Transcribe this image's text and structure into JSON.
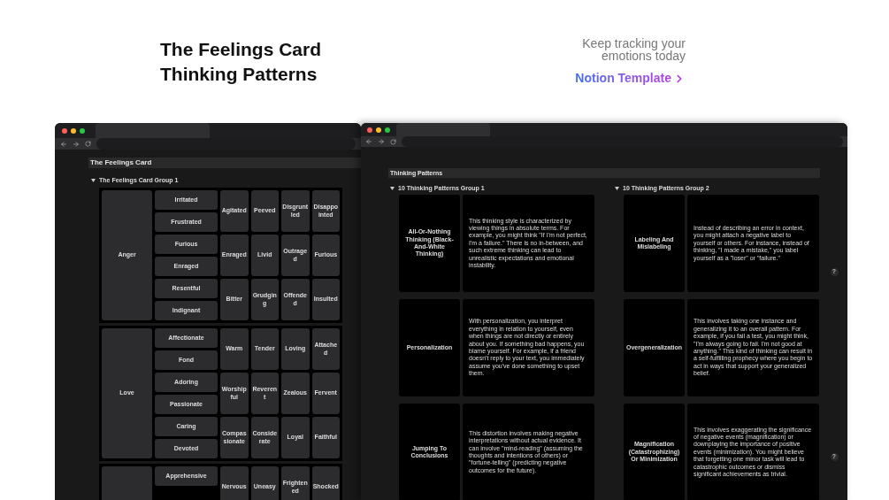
{
  "headline": {
    "title_lines": [
      "The Feelings Card",
      "Thinking Patterns"
    ],
    "tagline_lines": [
      "Keep tracking your",
      "emotions today"
    ],
    "link": "Notion Template"
  },
  "feelings_window": {
    "page_title": "The Feelings Card",
    "group_label": "The Feelings Card Group 1",
    "blocks": [
      {
        "primary": "Anger",
        "secondary": [
          "Irritated",
          "Frustrated",
          "Furious",
          "Enraged",
          "Resentful",
          "Indignant"
        ],
        "tertiary": [
          "Agitated",
          "Peeved",
          "Disgruntled",
          "Disappointed",
          "Enraged",
          "Livid",
          "Outraged",
          "Furious",
          "Bitter",
          "Grudging",
          "Offended",
          "Insulted"
        ]
      },
      {
        "primary": "Love",
        "secondary": [
          "Affectionate",
          "Fond",
          "Adoring",
          "Passionate",
          "Caring",
          "Devoted"
        ],
        "tertiary": [
          "Warm",
          "Tender",
          "Loving",
          "Attached",
          "Worshipful",
          "Reverent",
          "Zealous",
          "Fervent",
          "Compassionate",
          "Considerate",
          "Loyal",
          "Faithful"
        ]
      },
      {
        "secondary": [
          "Apprehensive"
        ],
        "tertiary": [
          "Nervous",
          "Uneasy",
          "Frightened",
          "Shocked"
        ]
      }
    ]
  },
  "patterns_window": {
    "page_title": "Thinking Patterns",
    "groups": [
      {
        "label": "10 Thinking Patterns Group 1",
        "cards": [
          {
            "name": "All-Or-Nothing Thinking (Black-And-White Thinking)",
            "description": "This thinking style is characterized by viewing things in absolute terms. For example, you might think \"If I'm not perfect, I'm a failure.\" There is no in-between, and such extreme thinking can lead to unrealistic expectations and emotional instability."
          },
          {
            "name": "Personalization",
            "description": "With personalization, you interpret everything in relation to yourself, even when things are not directly or entirely about you. If something bad happens, you blame yourself. For example, if a friend doesn't reply to your text, you immediately assume you've done something to upset them."
          },
          {
            "name": "Jumping To Conclusions",
            "description": "This distortion involves making negative interpretations without actual evidence. It can involve \"mind-reading\" (assuming the thoughts and intentions of others) or \"fortune-telling\" (predicting negative outcomes for the future)."
          }
        ]
      },
      {
        "label": "10 Thinking Patterns Group 2",
        "cards": [
          {
            "name": "Labeling And Mislabeling",
            "description": "Instead of describing an error in context, you might attach a negative label to yourself or others. For instance, instead of thinking, \"I made a mistake,\" you label yourself as a \"loser\" or \"failure.\""
          },
          {
            "name": "Overgeneralization",
            "description": "This involves taking one instance and generalizing it to an overall pattern. For example, if you fail a test, you might think, \"I'm always going to fail. I'm not good at anything.\" This kind of thinking can result in a self-fulfilling prophecy where you begin to act in ways that support your generalized belief."
          },
          {
            "name": "Magnification (Catastrophizing) Or Minimization",
            "description": "This involves exaggerating the significance of negative events (magnification) or downplaying the importance of positive events (minimization). You might believe that forgetting one minor task will lead to catastrophic outcomes or dismiss significant achievements as trivial."
          }
        ]
      }
    ],
    "help_buttons": [
      "?",
      "?"
    ]
  }
}
